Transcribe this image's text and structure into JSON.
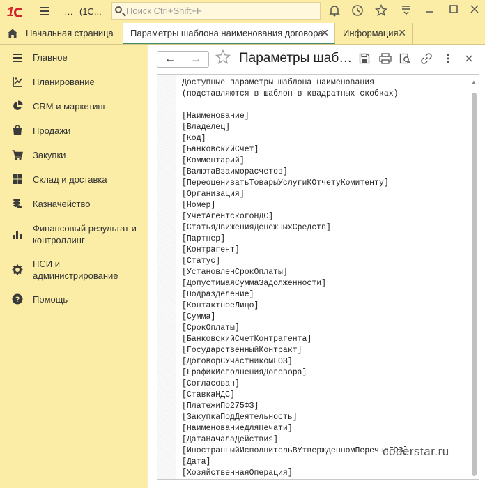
{
  "app": {
    "title": "(1С...",
    "menu_dots": "…",
    "search_placeholder": "Поиск Ctrl+Shift+F"
  },
  "tabs": [
    {
      "label": "Начальная страница"
    },
    {
      "label": "Параметры шаблона наименования договора",
      "close": "✕"
    },
    {
      "label": "Информация",
      "close": "✕"
    }
  ],
  "sidebar": {
    "items": [
      {
        "label": "Главное",
        "icon": "menu-list-icon"
      },
      {
        "label": "Планирование",
        "icon": "planning-icon"
      },
      {
        "label": "CRM и маркетинг",
        "icon": "pie-chart-icon"
      },
      {
        "label": "Продажи",
        "icon": "shopping-bag-icon"
      },
      {
        "label": "Закупки",
        "icon": "cart-icon"
      },
      {
        "label": "Склад и доставка",
        "icon": "warehouse-icon"
      },
      {
        "label": "Казначейство",
        "icon": "coins-icon"
      },
      {
        "label": "Финансовый результат и контроллинг",
        "icon": "bar-chart-icon"
      },
      {
        "label": "НСИ и администрирование",
        "icon": "gear-icon"
      },
      {
        "label": "Помощь",
        "icon": "help-icon"
      }
    ]
  },
  "form": {
    "title": "Параметры шаб…",
    "back_icon": "←",
    "forward_icon": "→",
    "lines": [
      "Доступные параметры шаблона наименования",
      "(подставляются в шаблон в квадратных скобках)",
      "",
      "[Наименование]",
      "[Владелец]",
      "[Код]",
      "[БанковскийСчет]",
      "[Комментарий]",
      "[ВалютаВзаиморасчетов]",
      "[ПереоцениватьТоварыУслугиКОтчетуКомитенту]",
      "[Организация]",
      "[Номер]",
      "[УчетАгентскогоНДС]",
      "[СтатьяДвиженияДенежныхСредств]",
      "[Партнер]",
      "[Контрагент]",
      "[Статус]",
      "[УстановленСрокОплаты]",
      "[ДопустимаяСуммаЗадолженности]",
      "[Подразделение]",
      "[КонтактноеЛицо]",
      "[Сумма]",
      "[СрокОплаты]",
      "[БанковскийСчетКонтрагента]",
      "[ГосударственныйКонтракт]",
      "[ДоговорСУчастникомГОЗ]",
      "[ГрафикИсполненияДоговора]",
      "[Согласован]",
      "[СтавкаНДС]",
      "[ПлатежиПо275ФЗ]",
      "[ЗакупкаПодДеятельность]",
      "[НаименованиеДляПечати]",
      "[ДатаНачалаДействия]",
      "[ИностранныйИсполнительВУтвержденномПеречнеГОЗ]",
      "[Дата]",
      "[ХозяйственнаяОперация]"
    ]
  },
  "watermark": "coderstar.ru",
  "colors": {
    "panel_bg": "#fbeda5",
    "accent_red": "#d6212a",
    "active_tab_underline": "#3e8f63"
  }
}
